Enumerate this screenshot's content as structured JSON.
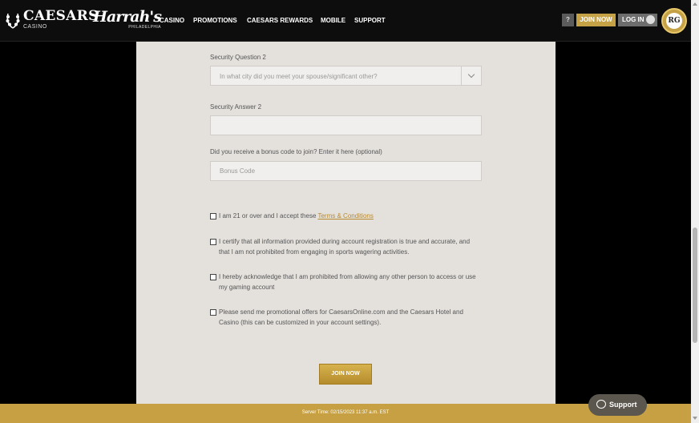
{
  "header": {
    "brand_main": "CAESARS",
    "brand_sub": "CASINO",
    "partner_main": "Harrah's",
    "partner_sub": "PHILADELPHIA",
    "nav": [
      {
        "label": "CASINO"
      },
      {
        "label": "PROMOTIONS"
      },
      {
        "label": "CAESARS REWARDS"
      },
      {
        "label": "MOBILE"
      },
      {
        "label": "SUPPORT"
      }
    ],
    "help_label": "?",
    "join_label": "JOIN NOW",
    "login_label": "LOG IN",
    "badge_label": "RG"
  },
  "form": {
    "security_question_label": "Security Question 2",
    "security_question_value": "In what city did you meet your spouse/significant other?",
    "security_answer_label": "Security Answer 2",
    "security_answer_value": "",
    "bonus_label": "Did you receive a bonus code to join? Enter it here (optional)",
    "bonus_placeholder": "Bonus Code",
    "checks": [
      {
        "text": "I am 21 or over and I accept these ",
        "link": "Terms & Conditions"
      },
      {
        "text": "I certify that all information provided during account registration is true and accurate, and that I am not prohibited from engaging in sports wagering activities."
      },
      {
        "text": "I hereby acknowledge that I am prohibited from allowing any other person to access or use my gaming account"
      },
      {
        "text": "Please send me promotional offers for CaesarsOnline.com and the Caesars Hotel and Casino (this can be customized in your account settings)."
      }
    ],
    "submit_label": "JOIN NOW"
  },
  "footer": {
    "server_time": "Server Time: 02/15/2023 11:37 a.m. EST"
  },
  "support": {
    "label": "Support"
  },
  "colors": {
    "accent_gold": "#c6a042",
    "panel_bg": "#e4e1dd",
    "link": "#b8892d"
  }
}
